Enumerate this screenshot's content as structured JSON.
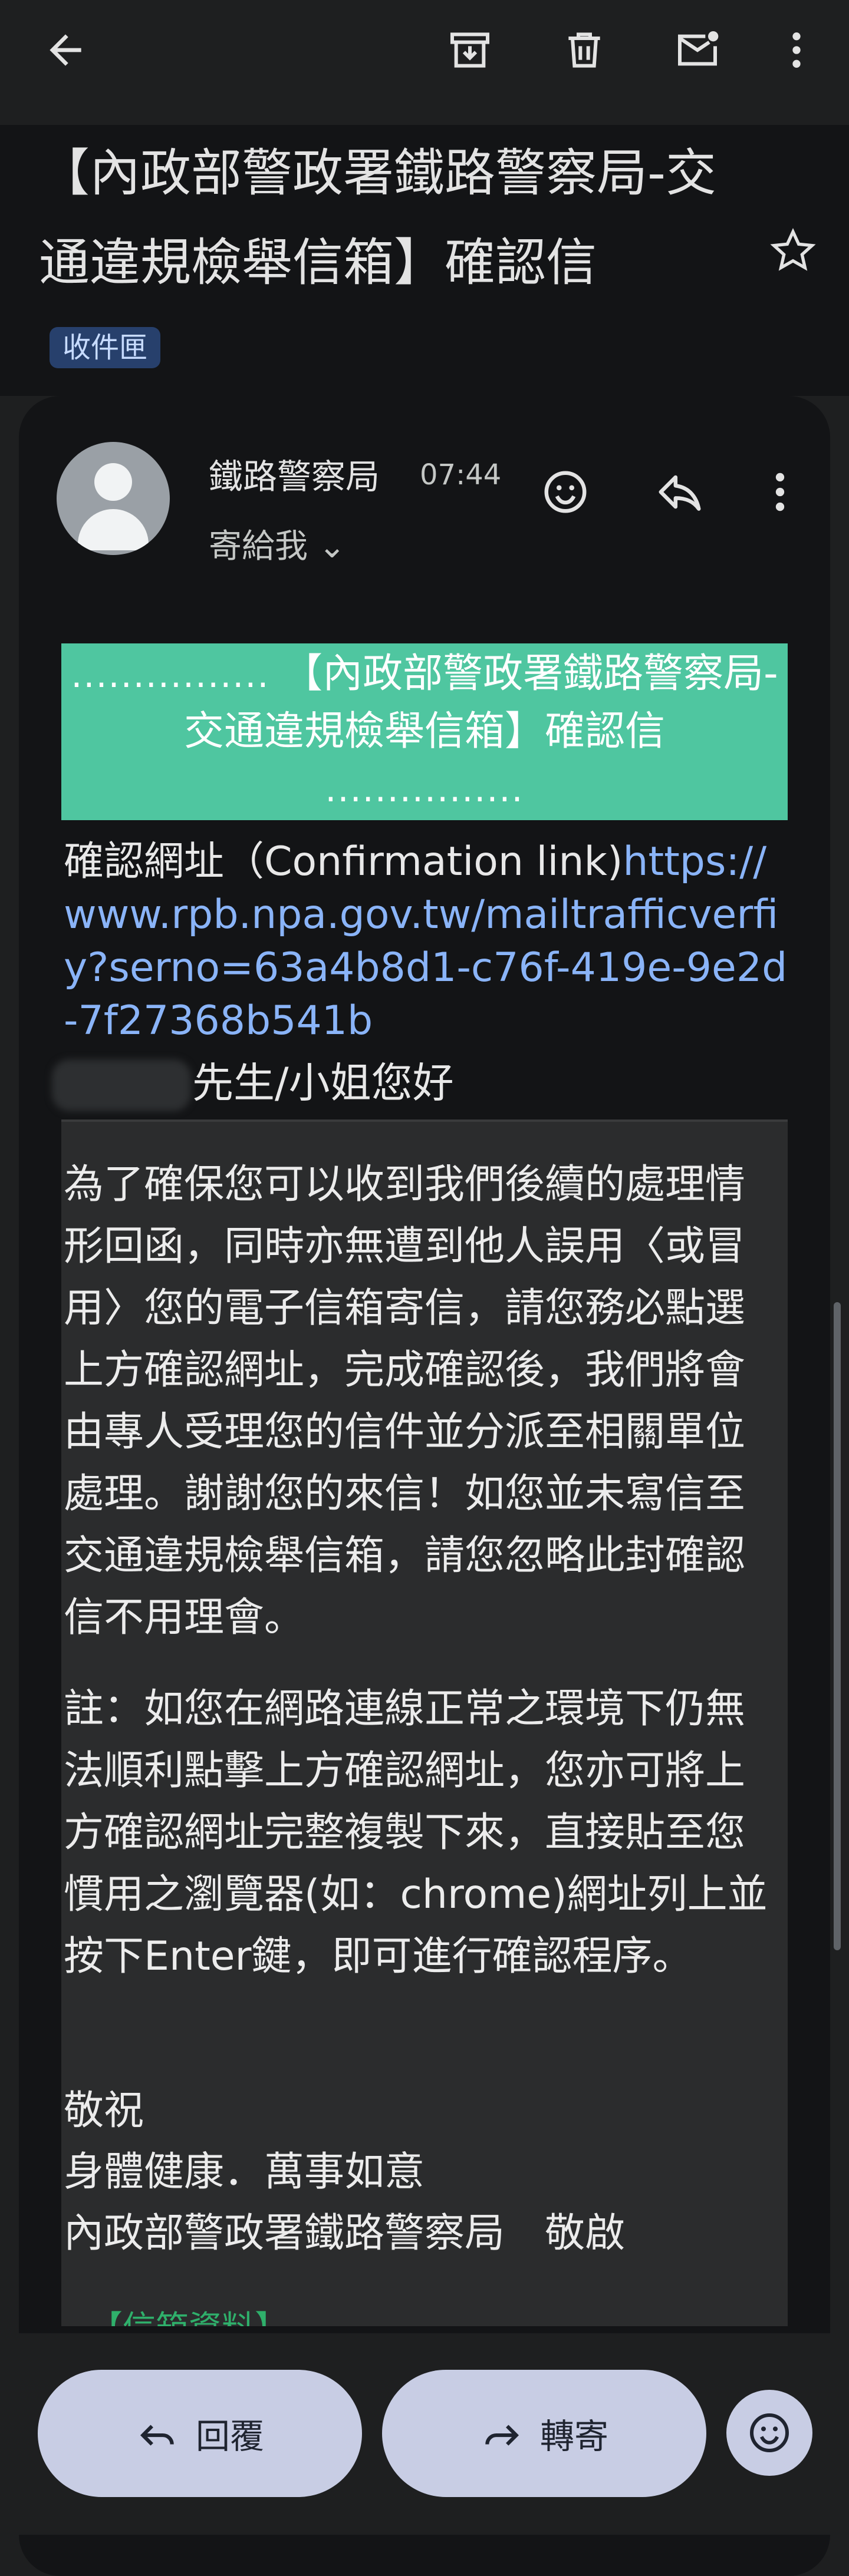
{
  "toolbar": {
    "back_icon": "arrow-left-icon",
    "archive_icon": "archive-icon",
    "delete_icon": "trash-icon",
    "mark_unread_icon": "mail-unread-icon",
    "more_icon": "more-vert-icon"
  },
  "email": {
    "subject": "【內政部警政署鐵路警察局-交通違規檢舉信箱】確認信",
    "label_chip": "收件匣",
    "sender": "鐵路警察局",
    "time": "07:44",
    "recipient": "寄給我 ⌄",
    "banner": {
      "dots_left": "................",
      "title": "【內政部警政署鐵路警察局-交通違規檢舉信箱】確認信",
      "dots_bottom": "................"
    },
    "confirmation_label": "確認網址（Confirmation link)",
    "confirmation_url": "https://www.rpb.npa.gov.tw/mailtrafficverfiy?serno=63a4b8d1-c76f-419e-9e2d-7f27368b541b",
    "greeting": "先生/小姐您好",
    "paragraph1": "為了確保您可以收到我們後續的處理情形回函，同時亦無遭到他人誤用〈或冒用〉您的電子信箱寄信，請您務必點選上方確認網址，完成確認後，我們將會由專人受理您的信件並分派至相關單位處理。謝謝您的來信！如您並未寫信至交通違規檢舉信箱，請您忽略此封確認信不用理會。",
    "paragraph2": "註：如您在網路連線正常之環境下仍無法順利點擊上方確認網址，您亦可將上方確認網址完整複製下來，直接貼至您慣用之瀏覽器(如：chrome)網址列上並按下Enter鍵，即可進行確認程序。",
    "signoff": {
      "line1": "敬祝",
      "line2": "身體健康．萬事如意",
      "line3": "內政部警政署鐵路警察局　敬啟"
    },
    "footer_peek": "【信箱資料】"
  },
  "actions": {
    "reply_label": "回覆",
    "forward_label": "轉寄"
  },
  "colors": {
    "background": "#1e1f20",
    "card": "#131416",
    "banner": "#4fc6a0",
    "link": "#8ab4f8",
    "chip": "#27406c",
    "pill": "#c8cde4"
  }
}
